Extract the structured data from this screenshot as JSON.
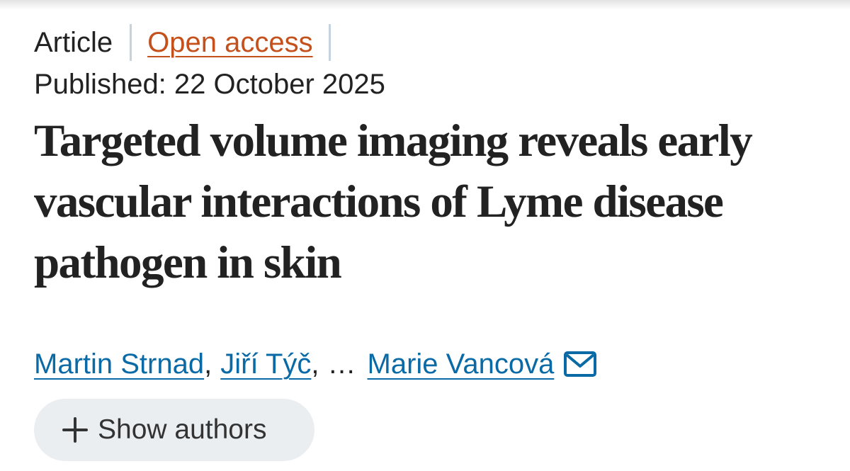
{
  "article": {
    "type": "Article",
    "access": "Open access",
    "published": "Published: 22 October 2025",
    "title": "Targeted volume imaging reveals early vascular interactions of Lyme disease pathogen in skin"
  },
  "authors": {
    "first": "Martin Strnad",
    "second": "Jiří Týč",
    "ellipsis": "…",
    "last": "Marie Vancová",
    "comma": ",",
    "contact_icon": "envelope-icon"
  },
  "show_authors": {
    "icon": "plus-icon",
    "label": "Show authors"
  },
  "colors": {
    "open_access": "#c4501c",
    "author_link": "#0a6aa6",
    "separator": "#c5d3df",
    "button_bg": "#ebeef1"
  }
}
